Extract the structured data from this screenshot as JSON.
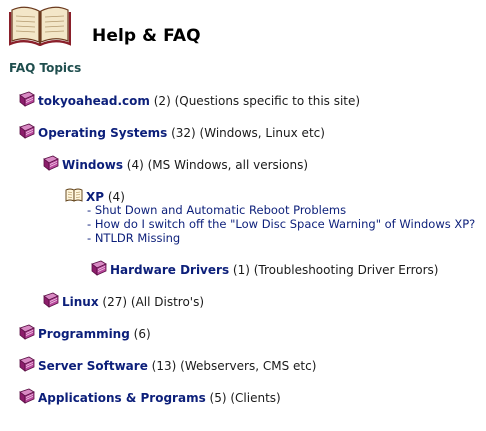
{
  "page": {
    "title": "Help & FAQ",
    "topics_heading": "FAQ Topics"
  },
  "topics": {
    "tokyoahead": {
      "name": "tokyoahead.com",
      "count": "(2)",
      "desc": "(Questions specific to this site)"
    },
    "os": {
      "name": "Operating Systems",
      "count": "(32)",
      "desc": "(Windows, Linux etc)"
    },
    "windows": {
      "name": "Windows",
      "count": "(4)",
      "desc": "(MS Windows, all versions)"
    },
    "xp": {
      "name": "XP",
      "count": "(4)",
      "questions": [
        "Shut Down and Automatic Reboot Problems",
        "How do I switch off the \"Low Disc Space Warning\" of Windows XP?",
        "NTLDR Missing"
      ]
    },
    "hardware": {
      "name": "Hardware Drivers",
      "count": "(1)",
      "desc": "(Troubleshooting Driver Errors)"
    },
    "linux": {
      "name": "Linux",
      "count": "(27)",
      "desc": "(All Distro's)"
    },
    "programming": {
      "name": "Programming",
      "count": "(6)",
      "desc": ""
    },
    "server": {
      "name": "Server Software",
      "count": "(13)",
      "desc": "(Webservers, CMS etc)"
    },
    "apps": {
      "name": "Applications & Programs",
      "count": "(5)",
      "desc": "(Clients)"
    }
  },
  "icons": {
    "header": "open-book-icon",
    "category": "closed-book-icon",
    "open_category": "open-book-icon"
  },
  "colors": {
    "link": "#0c1f7a",
    "book": "#a0247a",
    "heading": "#1f4e4e"
  }
}
